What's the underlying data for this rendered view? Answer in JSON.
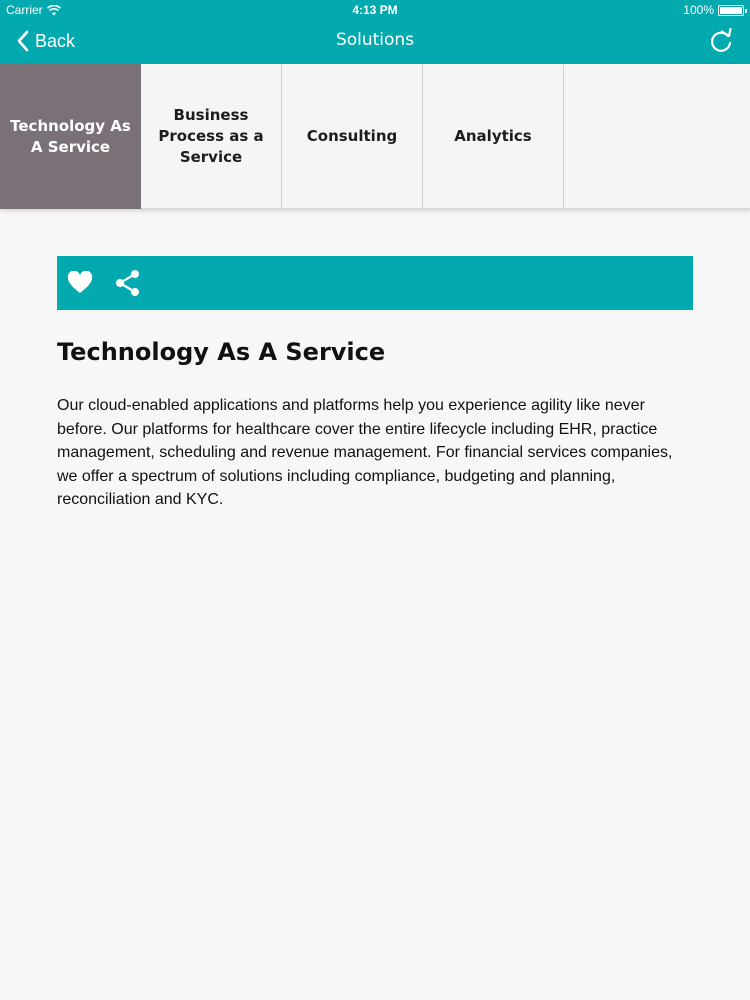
{
  "status_bar": {
    "carrier": "Carrier",
    "time": "4:13 PM",
    "battery": "100%"
  },
  "nav": {
    "back_label": "Back",
    "title": "Solutions"
  },
  "tabs": [
    {
      "label": "Technology As A Service",
      "active": true
    },
    {
      "label": "Business Process as a Service",
      "active": false
    },
    {
      "label": "Consulting",
      "active": false
    },
    {
      "label": "Analytics",
      "active": false
    }
  ],
  "actions": {
    "favorite_icon": "heart-icon",
    "share_icon": "share-icon"
  },
  "content": {
    "title": "Technology As A Service",
    "body": "Our cloud-enabled applications and platforms help you experience agility like never before. Our platforms for healthcare cover the entire lifecycle including EHR, practice management, scheduling and revenue management. For financial services companies, we offer a spectrum of solutions including compliance, budgeting and planning, reconciliation and KYC."
  },
  "colors": {
    "accent": "#02aab0",
    "active_tab": "#7a7078",
    "background": "#f7f7f8"
  }
}
